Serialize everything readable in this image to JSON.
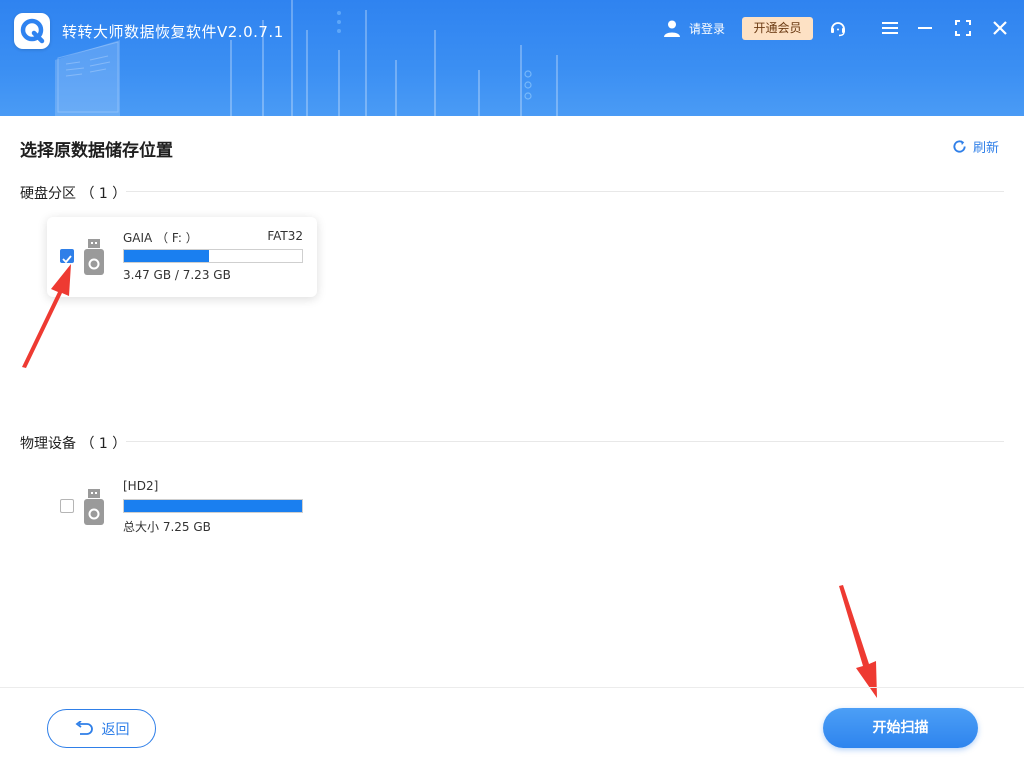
{
  "app": {
    "title": "转转大师数据恢复软件V2.0.7.1",
    "login_label": "请登录",
    "vip_label": "开通会员"
  },
  "main": {
    "title": "选择原数据储存位置",
    "refresh_label": "刷新"
  },
  "sections": {
    "partitions": {
      "title": "硬盘分区 （ 1 ）",
      "drives": [
        {
          "name": "GAIA （ F: ）",
          "filesystem": "FAT32",
          "size_text": "3.47 GB / 7.23 GB",
          "used_fraction": 0.48,
          "checked": true
        }
      ]
    },
    "physical": {
      "title": "物理设备 （ 1 ）",
      "drives": [
        {
          "name": "[HD2]",
          "size_text": "总大小 7.25 GB",
          "used_fraction": 1.0,
          "checked": false
        }
      ]
    }
  },
  "footer": {
    "back_label": "返回",
    "scan_label": "开始扫描"
  },
  "colors": {
    "accent": "#2f7fe8",
    "bar_fill": "#1a7ff0",
    "header_blue": "#3b8ff3",
    "vip_bg": "#fde1c4",
    "annotation_arrow": "#ee3a32"
  },
  "icons": [
    "app-logo-icon",
    "user-icon",
    "headset-icon",
    "menu-icon",
    "minimize-icon",
    "maximize-icon",
    "close-icon",
    "refresh-icon",
    "usb-drive-icon",
    "back-arrow-icon"
  ]
}
